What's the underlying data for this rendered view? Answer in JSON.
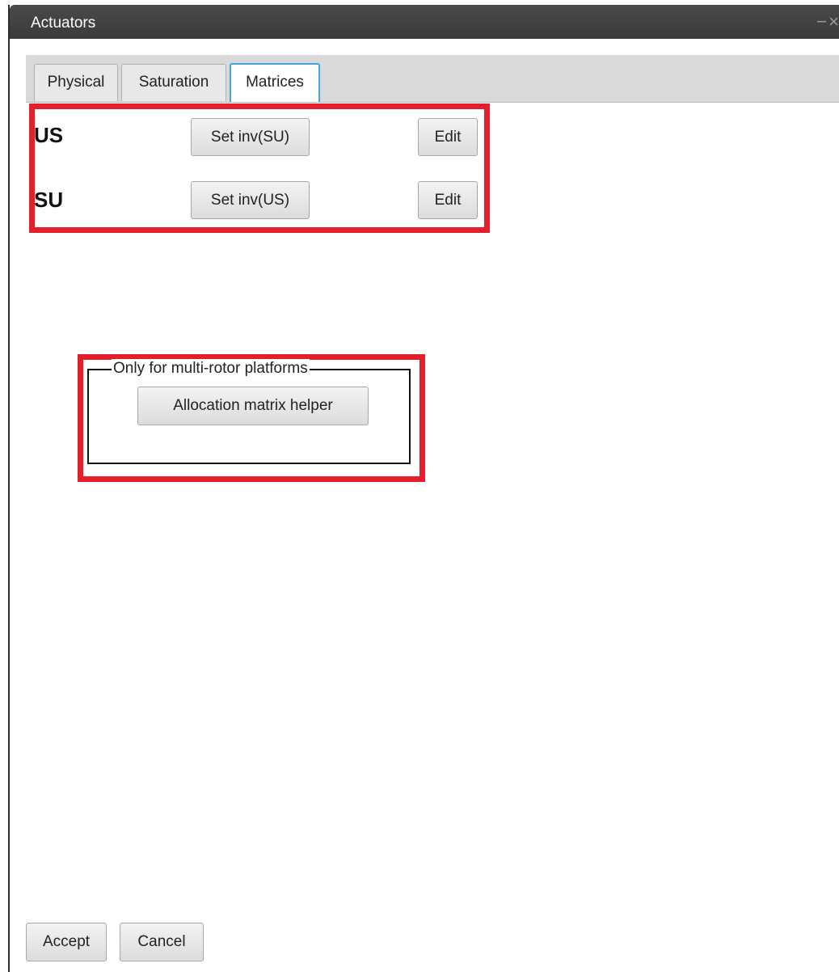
{
  "window": {
    "title": "Actuators",
    "minimize_label": "−",
    "close_label": "×"
  },
  "tabs": [
    {
      "label": "Physical"
    },
    {
      "label": "Saturation"
    },
    {
      "label": "Matrices",
      "active": true
    }
  ],
  "matrices": [
    {
      "name": "US",
      "set_label": "Set inv(SU)",
      "edit_label": "Edit"
    },
    {
      "name": "SU",
      "set_label": "Set inv(US)",
      "edit_label": "Edit"
    }
  ],
  "multirotor_group": {
    "title": "Only for multi-rotor platforms",
    "helper_button": "Allocation matrix helper"
  },
  "footer": {
    "accept_label": "Accept",
    "cancel_label": "Cancel"
  },
  "colors": {
    "highlight": "#e41e2a",
    "active_tab_border": "#44a3d9",
    "titlebar": "#3a3a3a"
  }
}
